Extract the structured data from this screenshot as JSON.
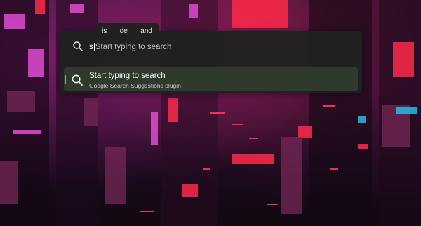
{
  "suggestions": [
    "is",
    "de",
    "and"
  ],
  "search": {
    "typed_text": "s",
    "placeholder": "Start typing to search"
  },
  "results": [
    {
      "title": "Start typing to search",
      "subtitle": "Google Search Suggestions plugin",
      "icon": "search-icon",
      "selected": true
    }
  ],
  "colors": {
    "panel": "#202120",
    "selected_row": "#2f3a2f",
    "accent": "#58a8ff",
    "text_primary": "#ffffff",
    "text_secondary": "#c9c9c9"
  }
}
